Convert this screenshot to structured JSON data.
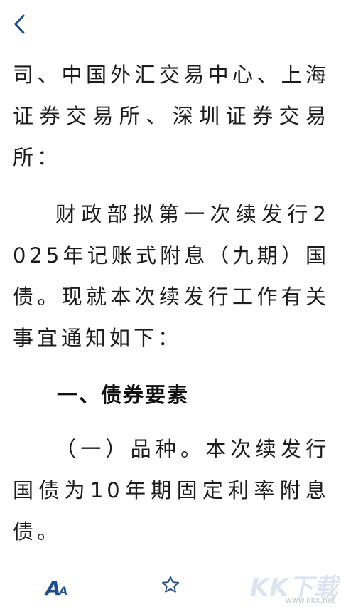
{
  "colors": {
    "accent": "#1f4e8c",
    "text": "#1c1c1c",
    "background": "#ffffff"
  },
  "header": {
    "back_icon": "chevron-left-icon"
  },
  "article": {
    "paragraphs": [
      "司、中国外汇交易中心、上海证券交易所、深圳证券交易所：",
      "财政部拟第一次续发行2025年记账式附息（九期）国债。现就本次续发行工作有关事宜通知如下：",
      "一、债券要素",
      "（一）品种。本次续发行国债为10年期固定利率附息债。"
    ]
  },
  "toolbar": {
    "font_size_icon": "font-size-icon",
    "font_size_label_large": "A",
    "font_size_label_small": "A",
    "favorite_icon": "star-outline-icon"
  },
  "watermark": {
    "text": "KK下载",
    "url": "www.kkx.net"
  }
}
